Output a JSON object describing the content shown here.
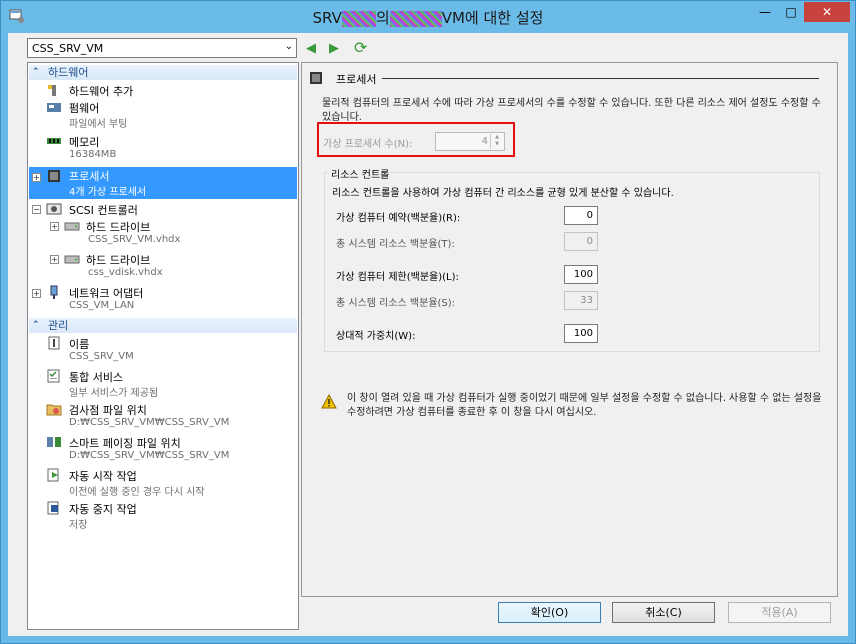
{
  "window": {
    "title_prefix": "SRV",
    "title_middle": "의",
    "title_suffix": "VM에 대한 설정",
    "btn_min": "—",
    "btn_max": "□",
    "btn_close": "✕"
  },
  "vm_selector": {
    "value": "CSS_SRV_VM",
    "arrow": "⌄"
  },
  "nav": {
    "back": "◀",
    "forward": "▶",
    "refresh": "⟳"
  },
  "tree": {
    "hardware_header": "하드웨어",
    "hardware_items": [
      {
        "label": "하드웨어 추가",
        "sub": ""
      },
      {
        "label": "펌웨어",
        "sub": "파일에서 부팅"
      },
      {
        "label": "메모리",
        "sub": "16384MB"
      },
      {
        "label": "프로세서",
        "sub": "4개 가상 프로세서"
      },
      {
        "label": "SCSI 컨트롤러",
        "sub": ""
      },
      {
        "label": "하드 드라이브",
        "sub": "CSS_SRV_VM.vhdx"
      },
      {
        "label": "하드 드라이브",
        "sub": "css_vdisk.vhdx"
      },
      {
        "label": "네트워크 어댑터",
        "sub": "CSS_VM_LAN"
      }
    ],
    "management_header": "관리",
    "management_items": [
      {
        "label": "이름",
        "sub": "CSS_SRV_VM"
      },
      {
        "label": "통합 서비스",
        "sub": "일부 서비스가 제공됨"
      },
      {
        "label": "검사점 파일 위치",
        "sub": "D:₩CSS_SRV_VM₩CSS_SRV_VM"
      },
      {
        "label": "스마트 페이징 파일 위치",
        "sub": "D:₩CSS_SRV_VM₩CSS_SRV_VM"
      },
      {
        "label": "자동 시작 작업",
        "sub": "이전에 실행 중인 경우 다시 시작"
      },
      {
        "label": "자동 중지 작업",
        "sub": "저장"
      }
    ]
  },
  "processor_panel": {
    "heading": "프로세서",
    "description": "물리적 컴퓨터의 프로세서 수에 따라 가상 프로세서의 수를 수정할 수 있습니다. 또한 다른 리소스 제어 설정도 수정할 수 있습니다.",
    "vcpu_label": "가상 프로세서 수(N):",
    "vcpu_value": "4",
    "resource_control": {
      "title": "리소스 컨트롤",
      "description": "리소스 컨트롤을 사용하여 가상 컴퓨터 간 리소스를 균형 있게 분산할 수 있습니다.",
      "fields": [
        {
          "label": "가상 컴퓨터 예약(백분율)(R):",
          "value": "0"
        },
        {
          "label": "총 시스템 리소스 백분율(T):",
          "value": "0"
        },
        {
          "label": "가상 컴퓨터 제한(백분율)(L):",
          "value": "100"
        },
        {
          "label": "총 시스템 리소스 백분율(S):",
          "value": "33"
        },
        {
          "label": "상대적 가중치(W):",
          "value": "100"
        }
      ]
    },
    "warning": "이 창이 열려 있을 때 가상 컴퓨터가 실행 중이었기 때문에 일부 설정을 수정할 수 없습니다. 사용할 수 없는 설정을 수정하려면 가상 컴퓨터를 종료한 후 이 창을 다시 여십시오."
  },
  "footer": {
    "ok": "확인(O)",
    "cancel": "취소(C)",
    "apply": "적용(A)"
  },
  "colors": {
    "titlebar": "#6bbbe9",
    "selection": "#3399ff",
    "highlight_box": "#e01010",
    "close_button": "#c7423d"
  }
}
